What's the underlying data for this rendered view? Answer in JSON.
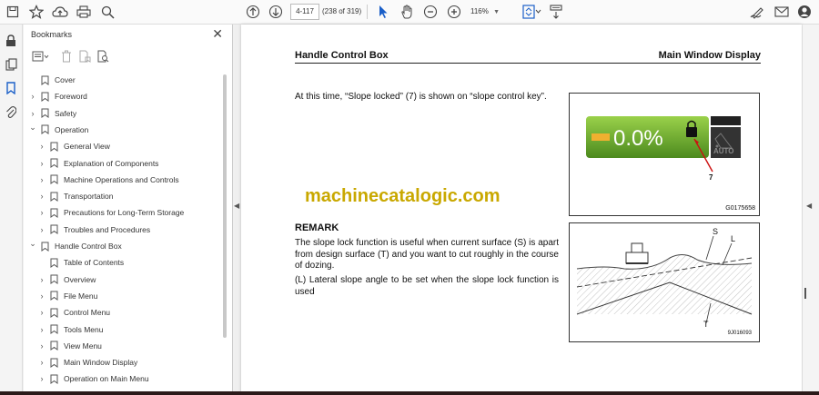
{
  "toolbar": {
    "page_input": "4-117",
    "page_count": "(238 of 319)",
    "zoom": "116%"
  },
  "bookmarks": {
    "title": "Bookmarks",
    "items": [
      {
        "label": "Cover",
        "level": 0,
        "expander": "none"
      },
      {
        "label": "Foreword",
        "level": 0,
        "expander": "collapsed"
      },
      {
        "label": "Safety",
        "level": 0,
        "expander": "collapsed"
      },
      {
        "label": " Operation",
        "level": 0,
        "expander": "expanded"
      },
      {
        "label": "General View",
        "level": 1,
        "expander": "collapsed"
      },
      {
        "label": "Explanation of Components",
        "level": 1,
        "expander": "collapsed"
      },
      {
        "label": "Machine Operations and Controls",
        "level": 1,
        "expander": "collapsed"
      },
      {
        "label": "Transportation",
        "level": 1,
        "expander": "collapsed"
      },
      {
        "label": "Precautions for Long-Term Storage",
        "level": 1,
        "expander": "collapsed"
      },
      {
        "label": "Troubles and Procedures",
        "level": 1,
        "expander": "collapsed"
      },
      {
        "label": "Handle Control Box",
        "level": 0,
        "expander": "expanded"
      },
      {
        "label": "Table of Contents",
        "level": 1,
        "expander": "none"
      },
      {
        "label": "Overview",
        "level": 1,
        "expander": "collapsed"
      },
      {
        "label": "File Menu",
        "level": 1,
        "expander": "collapsed"
      },
      {
        "label": "Control Menu",
        "level": 1,
        "expander": "collapsed"
      },
      {
        "label": "Tools Menu",
        "level": 1,
        "expander": "collapsed"
      },
      {
        "label": "View Menu",
        "level": 1,
        "expander": "collapsed"
      },
      {
        "label": "Main Window Display",
        "level": 1,
        "expander": "collapsed"
      },
      {
        "label": "Operation on Main Menu",
        "level": 1,
        "expander": "collapsed"
      }
    ]
  },
  "document": {
    "header_left": "Handle Control Box",
    "header_right": "Main Window Display",
    "para1": "At this time, “Slope locked” (7) is shown on “slope control key”.",
    "watermark": "machinecatalogic.com",
    "remark_title": "REMARK",
    "para2": "The slope lock function is useful when current surface (S) is apart from design surface (T) and you want to cut roughly in the course of dozing.",
    "para3": "(L) Lateral slope angle to be set when the slope lock function is used",
    "fig1": {
      "display_value": "0.0%",
      "auto_label": "AUTO",
      "callout": "7",
      "code": "G0175658"
    },
    "fig2": {
      "label_s": "S",
      "label_l": "L",
      "label_t": "T",
      "code": "9J016093"
    }
  }
}
